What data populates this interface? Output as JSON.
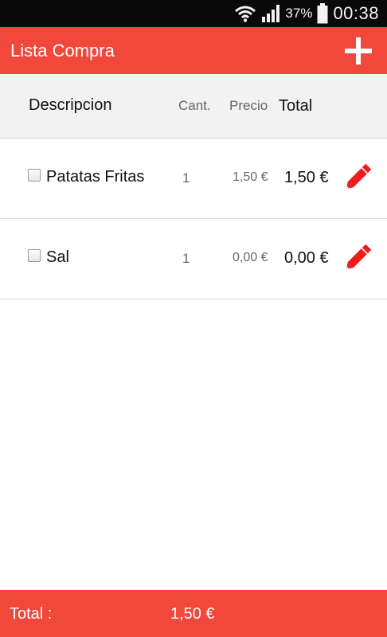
{
  "status_bar": {
    "battery_percent": "37%",
    "time": "00:38",
    "icons": [
      "wifi-icon",
      "signal-icon",
      "battery-icon"
    ]
  },
  "app_bar": {
    "title": "Lista Compra",
    "add_icon": "plus-icon"
  },
  "table_header": {
    "description": "Descripcion",
    "quantity": "Cant.",
    "price": "Precio",
    "total": "Total"
  },
  "items": [
    {
      "name": "Patatas Fritas",
      "quantity": "1",
      "price": "1,50 €",
      "total": "1,50 €",
      "checked": false,
      "edit_icon": "pencil-icon"
    },
    {
      "name": "Sal",
      "quantity": "1",
      "price": "0,00 €",
      "total": "0,00 €",
      "checked": false,
      "edit_icon": "pencil-icon"
    }
  ],
  "footer": {
    "label": "Total :",
    "value": "1,50 €"
  },
  "colors": {
    "accent": "#f2473b",
    "edit_icon": "#ee1c1c",
    "status_bar": "#0a0a0a",
    "header_bg": "#f2f2f2"
  }
}
